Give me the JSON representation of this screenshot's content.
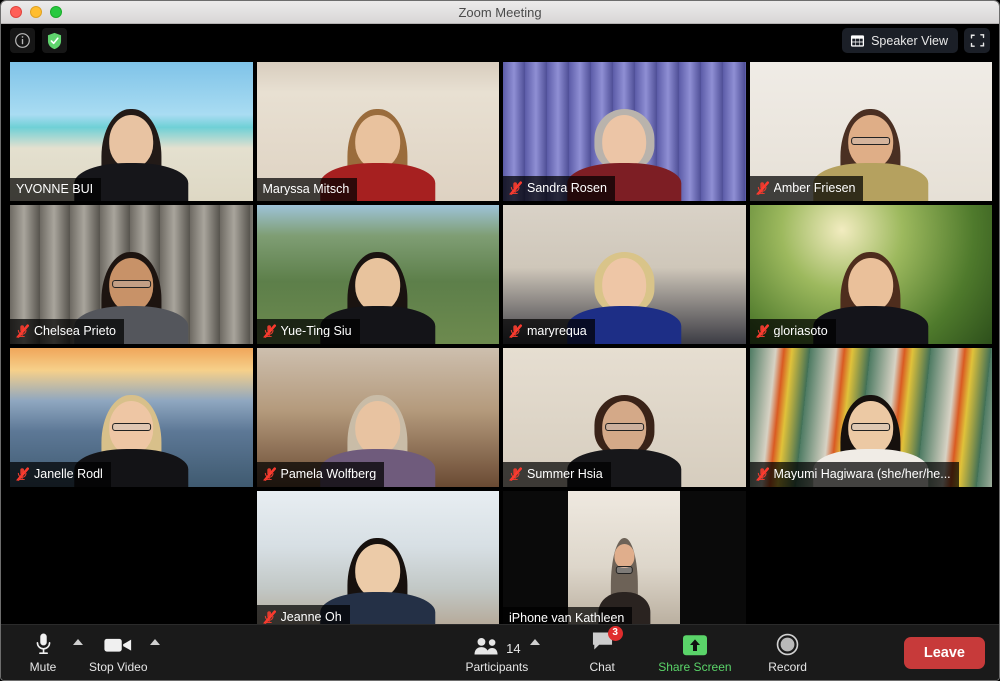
{
  "window": {
    "title": "Zoom Meeting",
    "traffic_lights": [
      "close",
      "minimize",
      "maximize"
    ]
  },
  "topbar": {
    "info_icon": "info-icon",
    "encryption_icon": "shield-check-icon",
    "view_button_label": "Speaker View",
    "view_button_icon": "grid-view-icon",
    "fullscreen_icon": "fullscreen-icon"
  },
  "gallery": {
    "columns": 4,
    "rows": 4,
    "participants": [
      {
        "name": "YVONNE BUI",
        "muted": false,
        "speaking": false,
        "row": 1,
        "col": 1,
        "portrait": false,
        "bg": "beach",
        "skin": "#e8c3a2",
        "hair": "#221a17",
        "hairlong": true,
        "shirt": "#16161a",
        "glasses": false
      },
      {
        "name": "Maryssa Mitsch",
        "muted": false,
        "speaking": true,
        "row": 1,
        "col": 2,
        "portrait": false,
        "bg": "room-beige",
        "skin": "#e9c29e",
        "hair": "#9a6c3c",
        "hairlong": true,
        "shirt": "#a62020",
        "glasses": false
      },
      {
        "name": "Sandra Rosen",
        "muted": true,
        "speaking": false,
        "row": 1,
        "col": 3,
        "portrait": false,
        "bg": "curtain-purple",
        "skin": "#ecc5a6",
        "hair": "#b9b3ac",
        "hairlong": false,
        "shirt": "#7d1e24",
        "glasses": false
      },
      {
        "name": "Amber Friesen",
        "muted": true,
        "speaking": false,
        "row": 1,
        "col": 4,
        "portrait": false,
        "bg": "gallery-wall",
        "skin": "#dfae87",
        "hair": "#4a2f22",
        "hairlong": true,
        "shirt": "#b5a15f",
        "glasses": true
      },
      {
        "name": "Chelsea Prieto",
        "muted": true,
        "speaking": false,
        "row": 2,
        "col": 1,
        "portrait": false,
        "bg": "concrete",
        "skin": "#c89268",
        "hair": "#1d1410",
        "hairlong": true,
        "shirt": "#54565c",
        "glasses": true
      },
      {
        "name": "Yue-Ting Siu",
        "muted": true,
        "speaking": false,
        "row": 2,
        "col": 2,
        "portrait": false,
        "bg": "garden",
        "skin": "#e8c39d",
        "hair": "#1a1310",
        "hairlong": true,
        "shirt": "#141418",
        "glasses": false
      },
      {
        "name": "maryrequa",
        "muted": true,
        "speaking": false,
        "row": 2,
        "col": 3,
        "portrait": false,
        "bg": "living-room",
        "skin": "#eec6a6",
        "hair": "#d9c489",
        "hairlong": false,
        "shirt": "#1d2e86",
        "glasses": false
      },
      {
        "name": "gloriasoto",
        "muted": true,
        "speaking": false,
        "row": 2,
        "col": 4,
        "portrait": false,
        "bg": "sunny-trees",
        "skin": "#eac09a",
        "hair": "#4e2d1d",
        "hairlong": true,
        "shirt": "#14141a",
        "glasses": false
      },
      {
        "name": "Janelle Rodl",
        "muted": true,
        "speaking": false,
        "row": 3,
        "col": 1,
        "portrait": false,
        "bg": "golden-gate",
        "skin": "#eec6a4",
        "hair": "#d8c08a",
        "hairlong": true,
        "shirt": "#131316",
        "glasses": true
      },
      {
        "name": "Pamela Wolfberg",
        "muted": true,
        "speaking": false,
        "row": 3,
        "col": 2,
        "portrait": false,
        "bg": "study",
        "skin": "#e8c3a1",
        "hair": "#c9bca7",
        "hairlong": true,
        "shirt": "#6f5b7c",
        "glasses": false
      },
      {
        "name": "Summer Hsia",
        "muted": true,
        "speaking": false,
        "row": 3,
        "col": 3,
        "portrait": false,
        "bg": "plain-wall",
        "skin": "#d4a988",
        "hair": "#3a2318",
        "hairlong": false,
        "shirt": "#17171a",
        "glasses": true
      },
      {
        "name": "Mayumi Hagiwara (she/her/he...",
        "muted": true,
        "speaking": false,
        "row": 3,
        "col": 4,
        "portrait": false,
        "bg": "art-mural",
        "skin": "#ecc9a4",
        "hair": "#16100d",
        "hairlong": true,
        "shirt": "#f0ece6",
        "glasses": true
      },
      {
        "name": "Jeanne Oh",
        "muted": true,
        "speaking": false,
        "row": 4,
        "col": 2,
        "portrait": false,
        "bg": "bay-window",
        "skin": "#eccba8",
        "hair": "#17110e",
        "hairlong": true,
        "shirt": "#243046",
        "glasses": false
      },
      {
        "name": "iPhone van Kathleen",
        "muted": false,
        "speaking": false,
        "row": 4,
        "col": 3,
        "portrait": true,
        "bg": "bright-indoor",
        "skin": "#e0ae8c",
        "hair": "#6d6257",
        "hairlong": true,
        "shirt": "#2a2320",
        "glasses": true
      }
    ]
  },
  "toolbar": {
    "mute": {
      "label": "Mute",
      "icon": "microphone-icon",
      "has_caret": true
    },
    "video": {
      "label": "Stop Video",
      "icon": "video-camera-icon",
      "has_caret": true
    },
    "participants": {
      "label": "Participants",
      "icon": "participants-icon",
      "count": "14",
      "has_caret": true
    },
    "chat": {
      "label": "Chat",
      "icon": "chat-bubble-icon",
      "badge": "3"
    },
    "share": {
      "label": "Share Screen",
      "icon": "share-screen-icon",
      "accent": "#5ad469"
    },
    "record": {
      "label": "Record",
      "icon": "record-icon"
    },
    "leave": {
      "label": "Leave",
      "color": "#c73a3a"
    }
  }
}
